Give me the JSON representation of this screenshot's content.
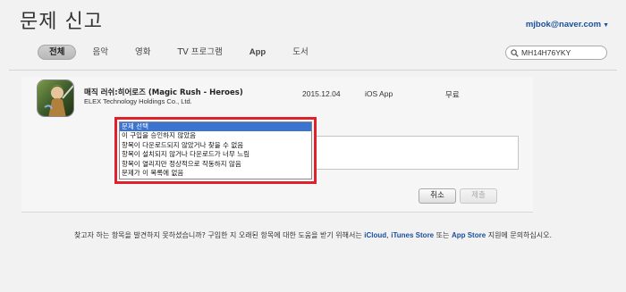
{
  "page": {
    "title": "문제 신고",
    "account_email": "mjbok@naver.com"
  },
  "tabs": [
    {
      "label": "전체",
      "active": true
    },
    {
      "label": "음악",
      "active": false
    },
    {
      "label": "영화",
      "active": false
    },
    {
      "label": "TV 프로그램",
      "active": false
    },
    {
      "label": "App",
      "active": false
    },
    {
      "label": "도서",
      "active": false
    }
  ],
  "search": {
    "value": "MH14H76YKY",
    "icon": "search-icon"
  },
  "purchase": {
    "app_name": "매직 러쉬:히어로즈 (Magic Rush - Heroes)",
    "developer": "ELEX Technology Holdings Co., Ltd.",
    "date": "2015.12.04",
    "platform": "iOS App",
    "price": "무료"
  },
  "problem_select": {
    "options": [
      "문제 선택",
      "이 구입을 승인하지 않았음",
      "항목이 다운로드되지 않았거나 찾을 수 없음",
      "항목이 설치되지 않거나 다운로드가 너무 느림",
      "항목이 열리지만 정상적으로 작동하지 않음",
      "문제가 이 목록에 없음"
    ],
    "selected_index": 0,
    "highlight_color": "#e0202a"
  },
  "buttons": {
    "cancel": "취소",
    "submit": "제출"
  },
  "footer": {
    "text_before": "찾고자 하는 항목을 발견하지 못하셨습니까? 구입한 지 오래된 항목에 대한 도움을 받기 위해서는 ",
    "link_icloud": "iCloud",
    "sep1": ", ",
    "link_itunes": "iTunes Store",
    "sep2": " 또는 ",
    "link_appstore": "App Store",
    "text_after": " 지원에 문의하십시오."
  }
}
